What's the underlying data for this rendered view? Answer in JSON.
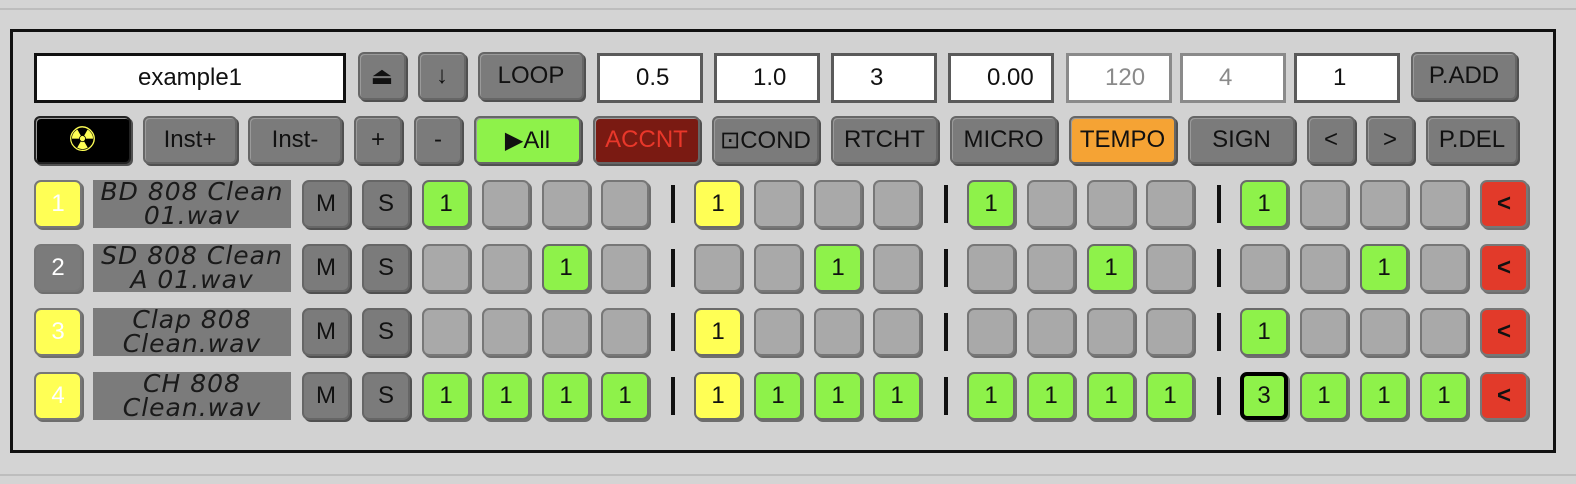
{
  "toolbar1": {
    "pattern_name": "example1",
    "eject_icon": "⏏",
    "down_icon": "↓",
    "loop_label": "LOOP",
    "fields": [
      "0.5",
      "1.0",
      "3",
      "0.00",
      "120",
      "4",
      "1"
    ],
    "padd_label": "P.ADD"
  },
  "toolbar2": {
    "radiation_icon": "☢",
    "inst_plus": "Inst+",
    "inst_minus": "Inst-",
    "plus": "+",
    "minus": "-",
    "play_all": "▶All",
    "accnt": "ACCNT",
    "cond": "⊡COND",
    "rtcht": "RTCHT",
    "micro": "MICRO",
    "tempo": "TEMPO",
    "sign": "SIGN",
    "prev": "<",
    "next": ">",
    "pdel": "P.DEL"
  },
  "tracks": [
    {
      "num": "1",
      "name": "BD 808 Clean 01.wav",
      "mute": "M",
      "solo": "S",
      "back": "<",
      "steps": [
        "1",
        "",
        "",
        "",
        "1",
        "",
        "",
        "",
        "1",
        "",
        "",
        "",
        "1",
        "",
        "",
        ""
      ],
      "step_colors": [
        "green",
        "",
        "",
        "",
        "yellow",
        "",
        "",
        "",
        "green",
        "",
        "",
        "",
        "green",
        "",
        "",
        ""
      ]
    },
    {
      "num": "2",
      "name": "SD 808 Clean A 01.wav",
      "mute": "M",
      "solo": "S",
      "back": "<",
      "steps": [
        "",
        "",
        "1",
        "",
        "",
        "",
        "1",
        "",
        "",
        "",
        "1",
        "",
        "",
        "",
        "1",
        ""
      ],
      "step_colors": [
        "",
        "",
        "green",
        "",
        "",
        "",
        "green",
        "",
        "",
        "",
        "green",
        "",
        "",
        "",
        "green",
        ""
      ]
    },
    {
      "num": "3",
      "name": "Clap 808 Clean.wav",
      "mute": "M",
      "solo": "S",
      "back": "<",
      "steps": [
        "",
        "",
        "",
        "",
        "1",
        "",
        "",
        "",
        "",
        "",
        "",
        "",
        "1",
        "",
        "",
        ""
      ],
      "step_colors": [
        "",
        "",
        "",
        "",
        "yellow",
        "",
        "",
        "",
        "",
        "",
        "",
        "",
        "green",
        "",
        "",
        ""
      ]
    },
    {
      "num": "4",
      "name": "CH 808 Clean.wav",
      "mute": "M",
      "solo": "S",
      "back": "<",
      "steps": [
        "1",
        "1",
        "1",
        "1",
        "1",
        "1",
        "1",
        "1",
        "1",
        "1",
        "1",
        "1",
        "3",
        "1",
        "1",
        "1"
      ],
      "step_colors": [
        "green",
        "green",
        "green",
        "green",
        "yellow",
        "green",
        "green",
        "green",
        "green",
        "green",
        "green",
        "green",
        "green",
        "green",
        "green",
        "green"
      ]
    }
  ],
  "colors": {
    "green": "#8ef24a",
    "yellow": "#ffff55",
    "red": "#e23a2a",
    "orange": "#f5a334",
    "dark_red": "#7a1a12"
  }
}
